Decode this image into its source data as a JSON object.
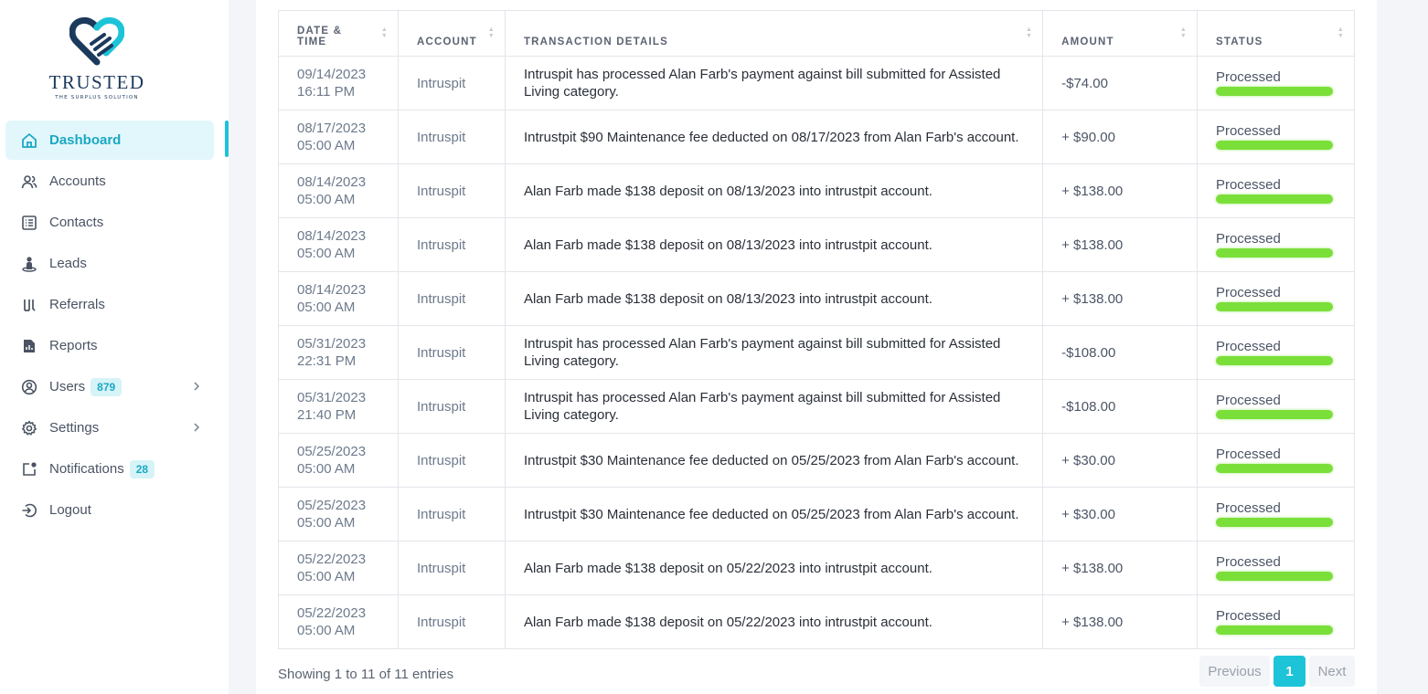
{
  "brand": {
    "name": "TRUSTED",
    "tagline": "THE SURPLUS SOLUTION",
    "accent": "#1dc4d8",
    "navy": "#1b3a5c"
  },
  "sidebar": {
    "items": [
      {
        "label": "Dashboard",
        "icon": "home-icon",
        "active": true
      },
      {
        "label": "Accounts",
        "icon": "users-icon"
      },
      {
        "label": "Contacts",
        "icon": "contacts-list-icon"
      },
      {
        "label": "Leads",
        "icon": "leads-person-icon"
      },
      {
        "label": "Referrals",
        "icon": "referrals-icon"
      },
      {
        "label": "Reports",
        "icon": "report-icon"
      },
      {
        "label": "Users",
        "icon": "user-circle-icon",
        "badge": "879",
        "chevron": true
      },
      {
        "label": "Settings",
        "icon": "gear-icon",
        "chevron": true
      },
      {
        "label": "Notifications",
        "icon": "notification-icon",
        "badge": "28"
      },
      {
        "label": "Logout",
        "icon": "logout-icon"
      }
    ]
  },
  "table": {
    "headers": {
      "date_line1": "DATE &",
      "date_line2": "TIME",
      "account": "ACCOUNT",
      "details": "TRANSACTION DETAILS",
      "amount": "AMOUNT",
      "status": "STATUS"
    },
    "rows": [
      {
        "date": "09/14/2023",
        "time": "16:11 PM",
        "account": "Intruspit",
        "details": "Intruspit has processed Alan Farb's payment against bill submitted for Assisted Living category.",
        "amount": "-$74.00",
        "status": "Processed"
      },
      {
        "date": "08/17/2023",
        "time": "05:00 AM",
        "account": "Intruspit",
        "details": "Intrustpit $90 Maintenance fee deducted on 08/17/2023 from Alan Farb's account.",
        "amount": "+ $90.00",
        "status": "Processed"
      },
      {
        "date": "08/14/2023",
        "time": "05:00 AM",
        "account": "Intruspit",
        "details": "Alan Farb made $138 deposit on 08/13/2023 into intrustpit account.",
        "amount": "+ $138.00",
        "status": "Processed"
      },
      {
        "date": "08/14/2023",
        "time": "05:00 AM",
        "account": "Intruspit",
        "details": "Alan Farb made $138 deposit on 08/13/2023 into intrustpit account.",
        "amount": "+ $138.00",
        "status": "Processed"
      },
      {
        "date": "08/14/2023",
        "time": "05:00 AM",
        "account": "Intruspit",
        "details": "Alan Farb made $138 deposit on 08/13/2023 into intrustpit account.",
        "amount": "+ $138.00",
        "status": "Processed"
      },
      {
        "date": "05/31/2023",
        "time": "22:31 PM",
        "account": "Intruspit",
        "details": "Intruspit has processed Alan Farb's payment against bill submitted for Assisted Living category.",
        "amount": "-$108.00",
        "status": "Processed"
      },
      {
        "date": "05/31/2023",
        "time": "21:40 PM",
        "account": "Intruspit",
        "details": "Intruspit has processed Alan Farb's payment against bill submitted for Assisted Living category.",
        "amount": "-$108.00",
        "status": "Processed"
      },
      {
        "date": "05/25/2023",
        "time": "05:00 AM",
        "account": "Intruspit",
        "details": "Intrustpit $30 Maintenance fee deducted on 05/25/2023 from Alan Farb's account.",
        "amount": "+ $30.00",
        "status": "Processed"
      },
      {
        "date": "05/25/2023",
        "time": "05:00 AM",
        "account": "Intruspit",
        "details": "Intrustpit $30 Maintenance fee deducted on 05/25/2023 from Alan Farb's account.",
        "amount": "+ $30.00",
        "status": "Processed"
      },
      {
        "date": "05/22/2023",
        "time": "05:00 AM",
        "account": "Intruspit",
        "details": "Alan Farb made $138 deposit on 05/22/2023 into intrustpit account.",
        "amount": "+ $138.00",
        "status": "Processed"
      },
      {
        "date": "05/22/2023",
        "time": "05:00 AM",
        "account": "Intruspit",
        "details": "Alan Farb made $138 deposit on 05/22/2023 into intrustpit account.",
        "amount": "+ $138.00",
        "status": "Processed"
      }
    ]
  },
  "footer": {
    "info": "Showing 1 to 11 of 11 entries",
    "previous": "Previous",
    "current_page": "1",
    "next": "Next"
  }
}
